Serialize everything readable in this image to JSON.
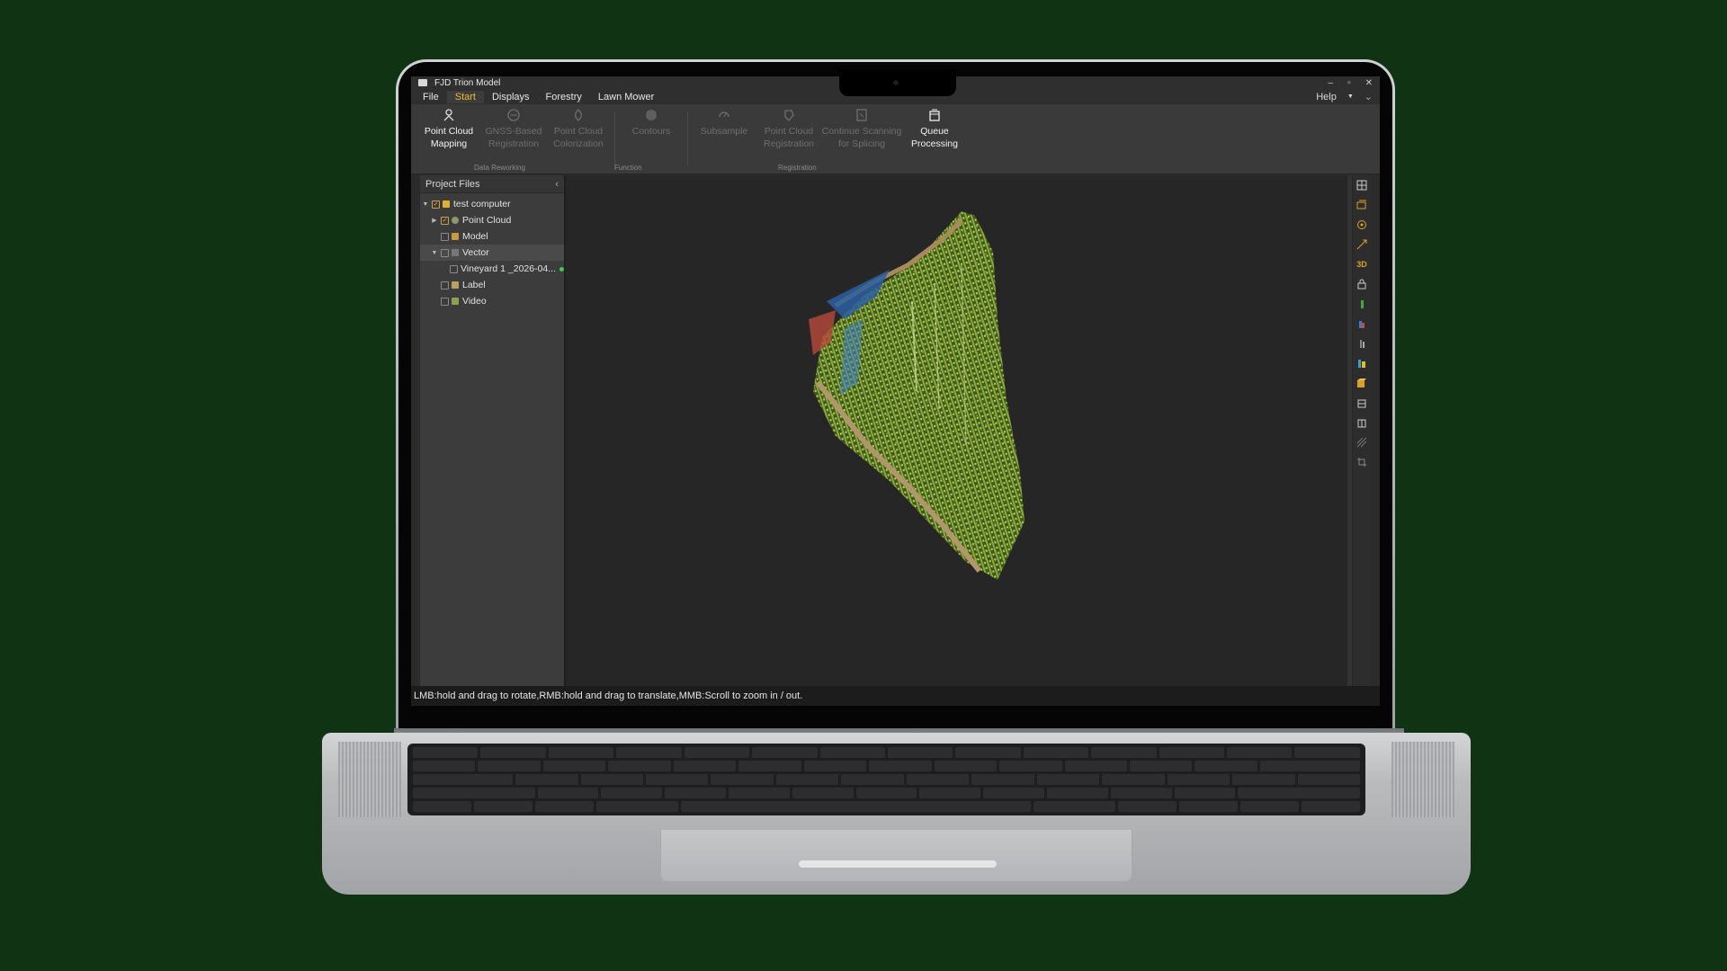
{
  "window": {
    "title": "FJD Trion Model",
    "controls": [
      "–",
      "▫",
      "✕"
    ]
  },
  "menu": {
    "items": [
      "File",
      "Start",
      "Displays",
      "Forestry",
      "Lawn Mower"
    ],
    "active": "Start",
    "help_label": "Help",
    "help_arrow": "▼",
    "collapse": "⌄"
  },
  "ribbon": {
    "buttons": [
      {
        "line1": "Point Cloud",
        "line2": "Mapping",
        "enabled": true
      },
      {
        "line1": "GNSS-Based",
        "line2": "Registration",
        "enabled": false
      },
      {
        "line1": "Point Cloud",
        "line2": "Colorization",
        "enabled": false
      },
      {
        "line1": "Contours",
        "line2": "",
        "enabled": false
      },
      {
        "line1": "Subsample",
        "line2": "",
        "enabled": false
      },
      {
        "line1": "Point Cloud",
        "line2": "Registration",
        "enabled": false
      },
      {
        "line1": "Continue Scanning",
        "line2": "for Splicing",
        "enabled": false
      },
      {
        "line1": "Queue",
        "line2": "Processing",
        "enabled": true
      }
    ],
    "groups": [
      "Data Reworking",
      "Function",
      "Registration"
    ]
  },
  "project_panel": {
    "title": "Project Files",
    "collapse": "‹",
    "items": [
      {
        "label": "test computer",
        "expand": "▼",
        "checked": true
      },
      {
        "label": "Point Cloud",
        "expand": "▶",
        "checked": true
      },
      {
        "label": "Model",
        "expand": "",
        "checked": false
      },
      {
        "label": "Vector",
        "expand": "▼",
        "checked": false
      },
      {
        "label": "Vineyard 1 _2026-04...",
        "expand": "",
        "checked": false
      },
      {
        "label": "Label",
        "expand": "",
        "checked": false
      },
      {
        "label": "Video",
        "expand": "",
        "checked": false
      }
    ]
  },
  "right_toolbar": {
    "tools": [
      "fit-view-icon",
      "layers-icon",
      "target-icon",
      "measure-icon",
      "3d-view-icon",
      "lock-icon",
      "color-height-icon",
      "color-rgb-icon",
      "intensity-icon",
      "classify-icon",
      "cube-icon",
      "front-view-icon",
      "side-view-icon",
      "hide-icon",
      "crop-icon"
    ],
    "label_3d": "3D"
  },
  "status": {
    "text": "LMB:hold and drag to rotate,RMB:hold and drag to translate,MMB:Scroll to zoom in / out."
  },
  "colors": {
    "accent": "#f0b82a",
    "background": "#0f3313",
    "panel": "#3c3c3c",
    "viewport": "#262626"
  }
}
